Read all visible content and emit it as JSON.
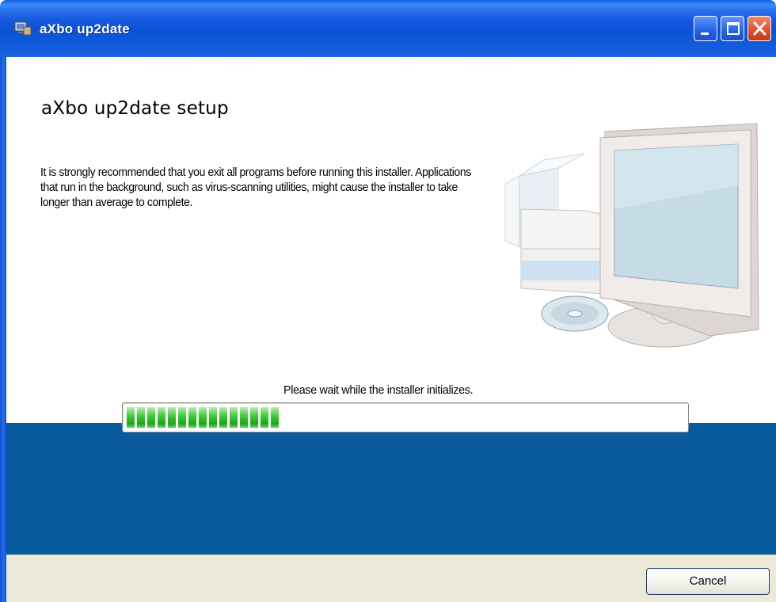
{
  "window": {
    "title": "aXbo up2date",
    "app_icon": "installer-app-icon",
    "controls": [
      "minimize-icon",
      "maximize-icon",
      "close-icon"
    ]
  },
  "main": {
    "heading": "aXbo up2date setup",
    "paragraph": "It is strongly recommended that you exit all programs before running this installer. Applications that run in the background, such as virus-scanning utilities, might cause the installer to take longer than average to complete.",
    "illustration": "computer-and-cd-illustration",
    "status_text": "Please wait while the installer initializes.",
    "progress_fraction": 0.28
  },
  "footer": {
    "cancel_label": "Cancel"
  },
  "colors": {
    "titlebar": "#0b52d6",
    "band": "#0a5aa0",
    "footer": "#ece9d8",
    "progress": "#2fbf2a"
  }
}
